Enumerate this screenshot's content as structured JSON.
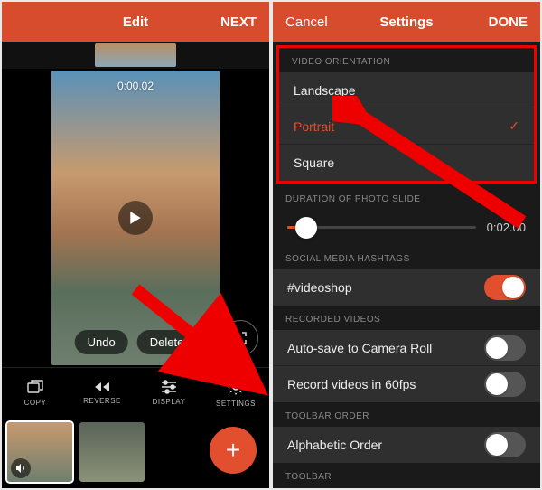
{
  "colors": {
    "accent": "#e24f2e",
    "header": "#d84c2e"
  },
  "left": {
    "header": {
      "back": "",
      "title": "Edit",
      "next": "NEXT"
    },
    "timecode": "0:00.02",
    "actions": {
      "undo": "Undo",
      "delete": "Delete"
    },
    "toolbar": [
      {
        "id": "copy",
        "label": "COPY"
      },
      {
        "id": "reverse",
        "label": "REVERSE"
      },
      {
        "id": "display",
        "label": "DISPLAY"
      },
      {
        "id": "settings",
        "label": "SETTINGS"
      }
    ],
    "fab": "+"
  },
  "right": {
    "header": {
      "cancel": "Cancel",
      "title": "Settings",
      "done": "DONE"
    },
    "sections": {
      "orientation": {
        "title": "VIDEO ORIENTATION",
        "options": [
          "Landscape",
          "Portrait",
          "Square"
        ],
        "selected": "Portrait"
      },
      "duration": {
        "title": "DURATION OF PHOTO SLIDE",
        "value": "0:02.00"
      },
      "hashtags": {
        "title": "SOCIAL MEDIA HASHTAGS",
        "item": "#videoshop",
        "on": true
      },
      "recorded": {
        "title": "RECORDED VIDEOS",
        "items": [
          {
            "label": "Auto-save to Camera Roll",
            "on": false
          },
          {
            "label": "Record videos in 60fps",
            "on": false
          }
        ]
      },
      "toolbar_order": {
        "title": "TOOLBAR ORDER",
        "item": "Alphabetic Order",
        "on": false
      },
      "toolbar2": {
        "title": "TOOLBAR"
      }
    }
  }
}
